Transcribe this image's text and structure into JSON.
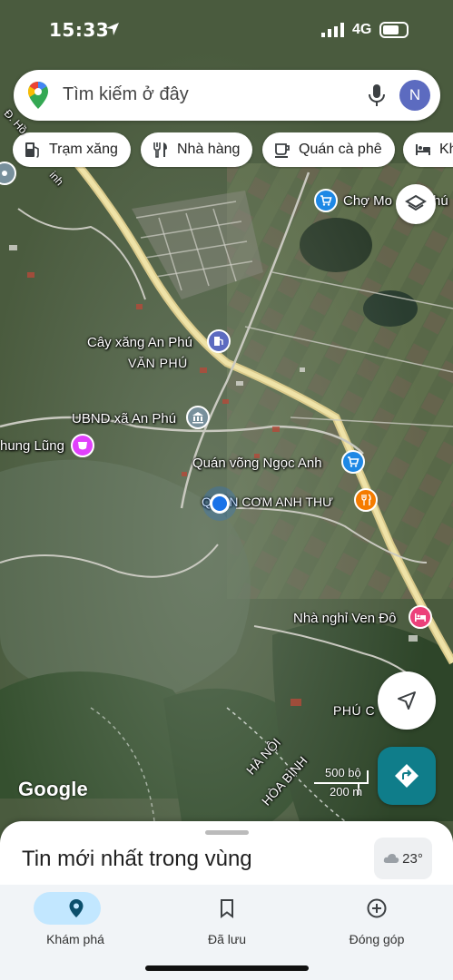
{
  "status_bar": {
    "time": "15:33",
    "network": "4G"
  },
  "search": {
    "placeholder": "Tìm kiếm ở đây",
    "avatar_letter": "N"
  },
  "chips": [
    {
      "label": "Trạm xăng",
      "icon": "gas-station-icon"
    },
    {
      "label": "Nhà hàng",
      "icon": "restaurant-icon"
    },
    {
      "label": "Quán cà phê",
      "icon": "coffee-icon"
    },
    {
      "label": "Kh",
      "icon": "hotel-icon"
    }
  ],
  "map": {
    "labels": {
      "cho": "Chợ Mo",
      "cho_tail": "hú",
      "cay_xang": "Cây xăng An Phú",
      "van_phu": "VĂN PHÚ",
      "ubnd": "UBND xã An Phú",
      "trung_lung": "hung Lũng",
      "quan_vong": "Quán võng Ngọc Anh",
      "quan_com": "QUÁN CƠM ANH THƯ",
      "nha_nghi": "Nhà nghỉ Ven Đô",
      "phu_c": "PHÚ C",
      "ha_noi": "HÀ NỘI",
      "hoa_binh": "HÒA BÌNH",
      "road": "Đ. Hồ",
      "road2": "inh"
    },
    "poi_colors": {
      "shopping": "#1e88e5",
      "fuel": "#5c6bc0",
      "civic": "#78909c",
      "entertainment": "#e040fb",
      "food": "#f57c00",
      "lodging": "#ec407a"
    },
    "google_logo": "Google",
    "scale_imperial": "500 bộ",
    "scale_metric": "200 m"
  },
  "sheet": {
    "title": "Tin mới nhất trong vùng",
    "weather": "23°"
  },
  "nav": [
    {
      "label": "Khám phá",
      "icon": "explore-pin-icon",
      "active": true
    },
    {
      "label": "Đã lưu",
      "icon": "bookmark-icon",
      "active": false
    },
    {
      "label": "Đóng góp",
      "icon": "add-circle-icon",
      "active": false
    }
  ],
  "colors": {
    "accent": "#1a73e8",
    "directions": "#0f7d8a",
    "nav_active": "#c2e7ff"
  }
}
